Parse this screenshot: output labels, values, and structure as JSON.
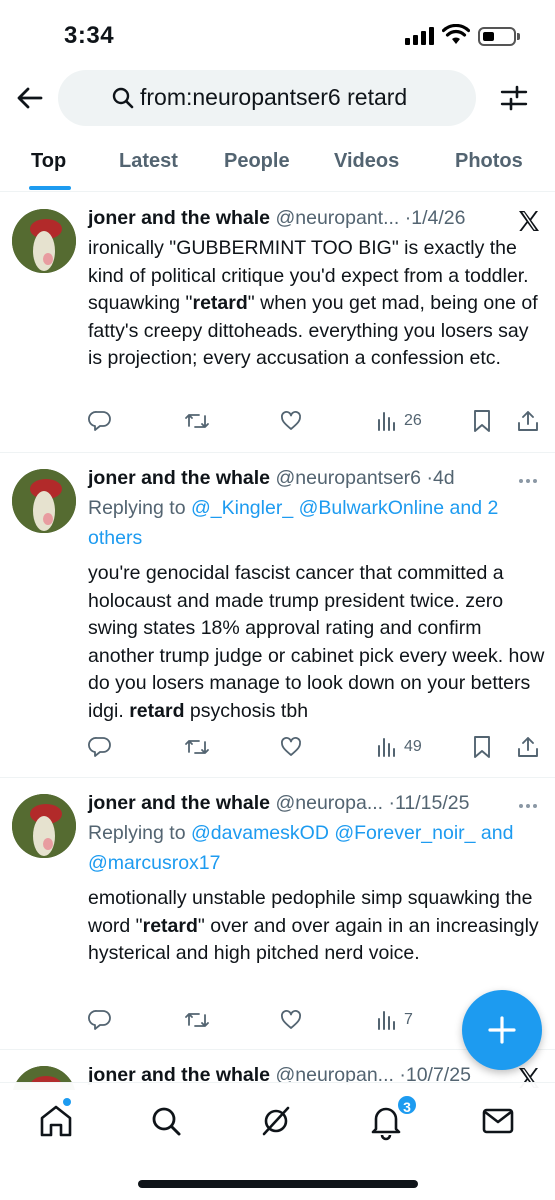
{
  "status_bar": {
    "time": "3:34"
  },
  "search": {
    "query": "from:neuropantser6 retard"
  },
  "tabs": [
    {
      "label": "Top",
      "active": true
    },
    {
      "label": "Latest",
      "active": false
    },
    {
      "label": "People",
      "active": false
    },
    {
      "label": "Videos",
      "active": false
    },
    {
      "label": "Photos",
      "active": false
    }
  ],
  "tweets": [
    {
      "name": "joner and the whale",
      "handle": "@neuropant...",
      "sep": "·",
      "time": "1/4/26",
      "text_pre": "ironically \"GUBBERMINT TOO BIG\" is exactly the kind of political critique you'd expect from a toddler. squawking \"",
      "bold": "retard",
      "text_post": "\" when you get mad, being one of fatty's creepy dittoheads. everything you losers say is projection; every accusation a confession etc.",
      "views": "26"
    },
    {
      "name": "joner and the whale",
      "handle": "@neuropantser6",
      "sep": "·",
      "time": "4d",
      "reply_prefix": "Replying to ",
      "reply_user1": "@_Kingler_",
      "reply_user2": "@BulwarkOnline",
      "reply_and": " and ",
      "reply_others": "2 others",
      "text_pre": "you're genocidal fascist cancer that committed a holocaust and made trump president twice. zero swing states 18% approval rating and confirm another trump judge or cabinet pick every week. how do you losers manage to look down on your betters idgi. ",
      "bold": "retard",
      "text_post": " psychosis tbh",
      "views": "49"
    },
    {
      "name": "joner and the whale",
      "handle": "@neuropa...",
      "sep": "·",
      "time": "11/15/25",
      "reply_prefix": "Replying to ",
      "reply_user1": "@davameskOD",
      "reply_user2": "@Forever_noir_",
      "reply_and": " and ",
      "reply_user3": "@marcusrox17",
      "text_pre": "emotionally unstable pedophile simp squawking the word \"",
      "bold": "retard",
      "text_post": "\" over and over again in an increasingly hysterical and high pitched nerd voice.",
      "views": "7"
    },
    {
      "name": "joner and the whale",
      "handle": "@neuropan...",
      "sep": "·",
      "time": "10/7/25"
    }
  ],
  "nav": {
    "notifications_badge": "3"
  },
  "icons": {
    "back": "arrow-left-icon",
    "search": "search-icon",
    "filter": "sliders-icon",
    "reply": "comment-icon",
    "retweet": "retweet-icon",
    "like": "heart-icon",
    "views": "bar-chart-icon",
    "bookmark": "bookmark-icon",
    "share": "share-icon",
    "more": "more-dots-icon",
    "x": "x-logo-icon",
    "compose": "plus-icon",
    "home": "home-icon",
    "explore": "search-icon",
    "grok": "grok-icon",
    "notifications": "bell-icon",
    "messages": "envelope-icon"
  },
  "colors": {
    "accent": "#1d9bf0",
    "text": "#0f1419",
    "secondary": "#536471"
  }
}
